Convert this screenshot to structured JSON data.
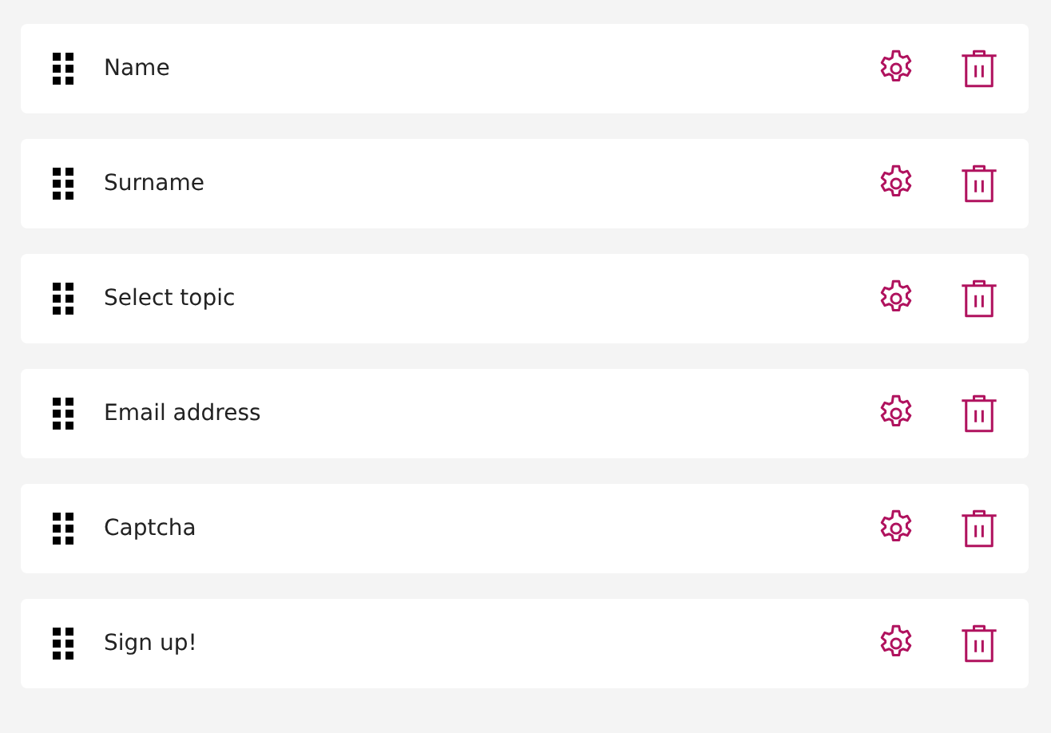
{
  "fields": [
    {
      "label": "Name"
    },
    {
      "label": "Surname"
    },
    {
      "label": "Select topic"
    },
    {
      "label": "Email address"
    },
    {
      "label": "Captcha"
    },
    {
      "label": "Sign up!"
    }
  ]
}
